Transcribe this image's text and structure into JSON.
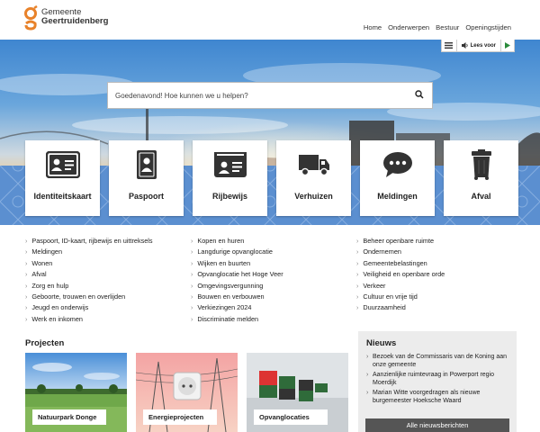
{
  "header": {
    "logo_line1": "Gemeente",
    "logo_line2": "Geertruidenberg",
    "brand_color": "#e8822a",
    "nav": [
      "Home",
      "Onderwerpen",
      "Bestuur",
      "Openingstijden"
    ]
  },
  "readspeaker": {
    "label": "Lees voor"
  },
  "search": {
    "placeholder": "Goedenavond! Hoe kunnen we u helpen?"
  },
  "tiles": [
    {
      "label": "Identiteitskaart",
      "icon": "id-card-icon"
    },
    {
      "label": "Paspoort",
      "icon": "passport-icon"
    },
    {
      "label": "Rijbewijs",
      "icon": "drivers-license-icon"
    },
    {
      "label": "Verhuizen",
      "icon": "moving-truck-icon"
    },
    {
      "label": "Meldingen",
      "icon": "chat-bubble-icon"
    },
    {
      "label": "Afval",
      "icon": "waste-bin-icon"
    }
  ],
  "links": {
    "col1": [
      "Paspoort, ID-kaart, rijbewijs en uittreksels",
      "Meldingen",
      "Wonen",
      "Afval",
      "Zorg en hulp",
      "Geboorte, trouwen en overlijden",
      "Jeugd en onderwijs",
      "Werk en inkomen"
    ],
    "col2": [
      "Kopen en huren",
      "Langdurige opvanglocatie",
      "Wijken en buurten",
      "Opvanglocatie het Hoge Veer",
      "Omgevingsvergunning",
      "Bouwen en verbouwen",
      "Verkiezingen 2024",
      "Discriminatie melden"
    ],
    "col3": [
      "Beheer openbare ruimte",
      "Ondernemen",
      "Gemeentebelastingen",
      "Veiligheid en openbare orde",
      "Verkeer",
      "Cultuur en vrije tijd",
      "Duurzaamheid"
    ]
  },
  "projecten": {
    "title": "Projecten",
    "cards": [
      "Natuurpark Donge",
      "Energieprojecten",
      "Opvanglocaties"
    ]
  },
  "nieuws": {
    "title": "Nieuws",
    "items": [
      "Bezoek van de Commissaris van de Koning aan onze gemeente",
      "Aanzienlijke ruimtevraag in Powerport regio Moerdijk",
      "Marian Witte voorgedragen als nieuwe burgemeester Hoeksche Waard"
    ],
    "button": "Alle nieuwsberichten"
  }
}
